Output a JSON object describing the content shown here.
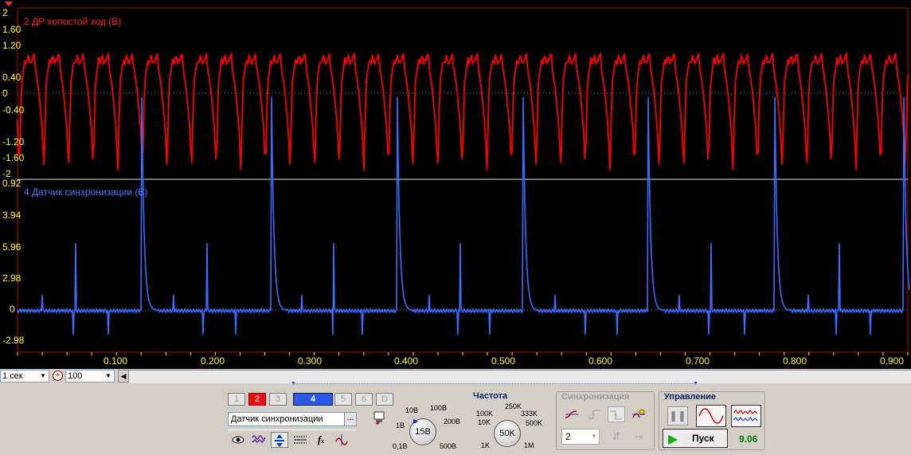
{
  "channel2": {
    "title": "2 ДР холостой ход (В)",
    "color": "#ff0000",
    "y_ticks": [
      "2",
      "1.60",
      "1.20",
      "0.40",
      "0",
      "-0.40",
      "-1.20",
      "-1.60",
      "-2"
    ]
  },
  "channel4": {
    "title": "4 Датчик синхронизации (В)",
    "color": "#3a6cff",
    "y_ticks": [
      "0.92",
      "3.94",
      "5.96",
      "2.98",
      "0",
      "-2.98"
    ]
  },
  "x_ticks": [
    "0.100",
    "0.200",
    "0.300",
    "0.400",
    "0.500",
    "0.600",
    "0.700",
    "0.800",
    "0.900"
  ],
  "zoom": {
    "time_value": "1 сек",
    "zoom_value": "100"
  },
  "channel_buttons": [
    "1",
    "2",
    "3",
    "4",
    "5",
    "6",
    "D"
  ],
  "channel_name": "Датчик синхронизации",
  "channel_name_btn": "...",
  "voltage_knob": {
    "value": "15В",
    "labels": [
      "10В",
      "100В",
      "1В",
      "200В",
      "0,1В",
      "500В"
    ]
  },
  "frequency": {
    "title": "Частота",
    "value": "50K",
    "labels": [
      "250K",
      "100K",
      "333K",
      "10K",
      "500K",
      "1K",
      "1M"
    ]
  },
  "sync": {
    "title": "Синхронизация",
    "channel_value": "2"
  },
  "control": {
    "title": "Управление",
    "start_label": "Пуск",
    "readout": "9.06"
  },
  "colors": {
    "scope_bg": "#000000",
    "grid_dots": "#2aa8a8",
    "axis_labels": "#ffff00",
    "panel_bg": "#d4d0c8"
  }
}
